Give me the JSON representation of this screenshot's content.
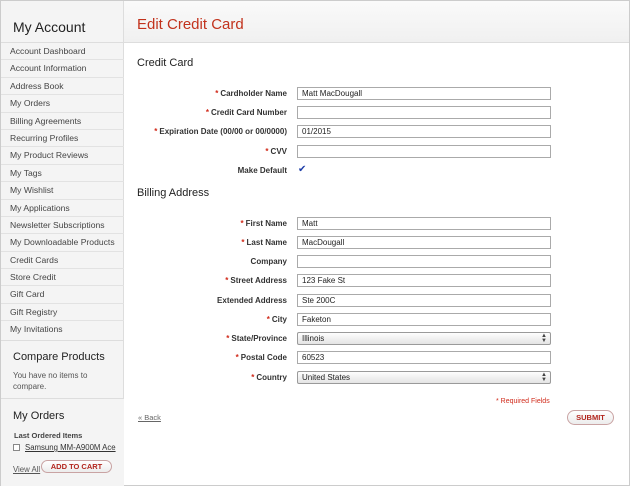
{
  "sidebar": {
    "title": "My Account",
    "items": [
      {
        "label": "Account Dashboard"
      },
      {
        "label": "Account Information"
      },
      {
        "label": "Address Book"
      },
      {
        "label": "My Orders"
      },
      {
        "label": "Billing Agreements"
      },
      {
        "label": "Recurring Profiles"
      },
      {
        "label": "My Product Reviews"
      },
      {
        "label": "My Tags"
      },
      {
        "label": "My Wishlist"
      },
      {
        "label": "My Applications"
      },
      {
        "label": "Newsletter Subscriptions"
      },
      {
        "label": "My Downloadable Products"
      },
      {
        "label": "Credit Cards"
      },
      {
        "label": "Store Credit"
      },
      {
        "label": "Gift Card"
      },
      {
        "label": "Gift Registry"
      },
      {
        "label": "My Invitations"
      }
    ],
    "compare": {
      "title": "Compare Products",
      "text": "You have no items to compare."
    },
    "orders": {
      "title": "My Orders",
      "subtitle": "Last Ordered Items",
      "item": "Samsung MM-A900M Ace",
      "view_all": "View All",
      "add_to_cart": "ADD TO CART"
    }
  },
  "page": {
    "title": "Edit Credit Card"
  },
  "credit_card": {
    "section_title": "Credit Card",
    "fields": {
      "cardholder_name": {
        "label": "Cardholder Name",
        "value": "Matt MacDougall"
      },
      "card_number": {
        "label": "Credit Card Number",
        "value": ""
      },
      "expiration": {
        "label": "Expiration Date (00/00 or 00/0000)",
        "value": "01/2015"
      },
      "cvv": {
        "label": "CVV",
        "value": ""
      },
      "make_default": {
        "label": "Make Default",
        "checked": true
      }
    }
  },
  "billing": {
    "section_title": "Billing Address",
    "fields": {
      "first_name": {
        "label": "First Name",
        "value": "Matt"
      },
      "last_name": {
        "label": "Last Name",
        "value": "MacDougall"
      },
      "company": {
        "label": "Company",
        "value": ""
      },
      "street": {
        "label": "Street Address",
        "value": "123 Fake St"
      },
      "extended": {
        "label": "Extended Address",
        "value": "Ste 200C"
      },
      "city": {
        "label": "City",
        "value": "Faketon"
      },
      "state": {
        "label": "State/Province",
        "value": "Illinois"
      },
      "postal": {
        "label": "Postal Code",
        "value": "60523"
      },
      "country": {
        "label": "Country",
        "value": "United States"
      }
    }
  },
  "form": {
    "required_star": "*",
    "required_note": "* Required Fields",
    "back_label": "« Back",
    "submit_label": "SUBMIT"
  },
  "colors": {
    "accent": "#c2321c",
    "required": "#d12b1b"
  }
}
